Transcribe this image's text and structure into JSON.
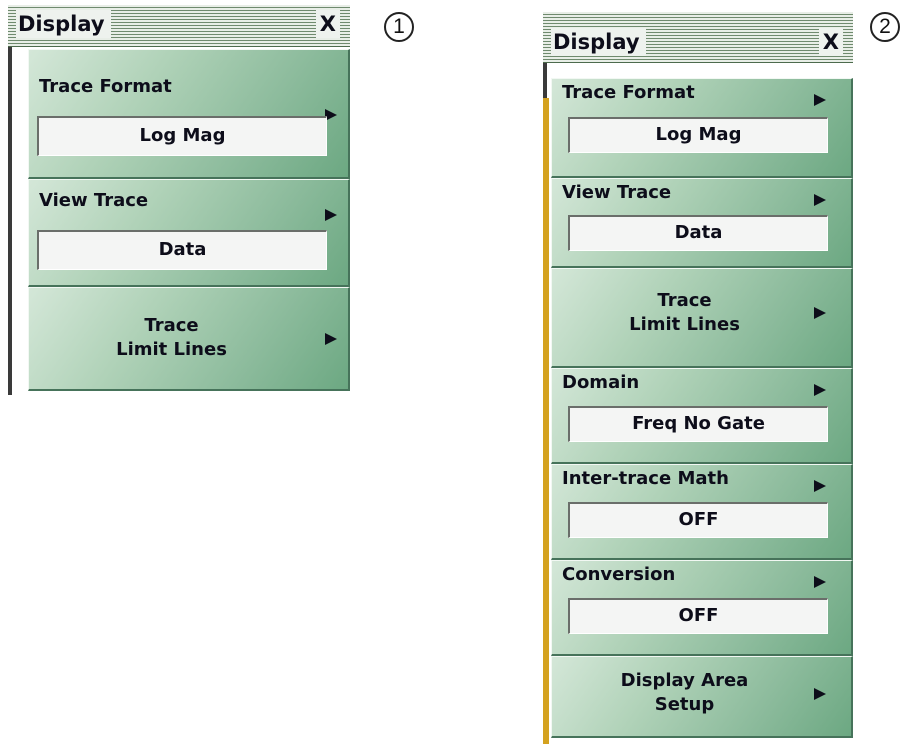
{
  "callouts": [
    "1",
    "2"
  ],
  "panels": [
    {
      "title": "Display",
      "close_label": "X",
      "items": [
        {
          "label": "Trace Format",
          "value": "Log Mag"
        },
        {
          "label": "View Trace",
          "value": "Data"
        },
        {
          "label": "Trace\nLimit Lines"
        }
      ]
    },
    {
      "title": "Display",
      "close_label": "X",
      "items": [
        {
          "label": "Trace Format",
          "value": "Log Mag"
        },
        {
          "label": "View Trace",
          "value": "Data"
        },
        {
          "label": "Trace\nLimit Lines"
        },
        {
          "label": "Domain",
          "value": "Freq No Gate"
        },
        {
          "label": "Inter-trace Math",
          "value": "OFF"
        },
        {
          "label": "Conversion",
          "value": "OFF"
        },
        {
          "label": "Display Area\nSetup"
        }
      ]
    }
  ],
  "icons": {
    "submenu": "right-triangle-arrow-icon"
  },
  "colors": {
    "button_green": "#8cbb9c",
    "title_stripe": "#6f8a6e",
    "accent_bar": "#d4a21f"
  }
}
